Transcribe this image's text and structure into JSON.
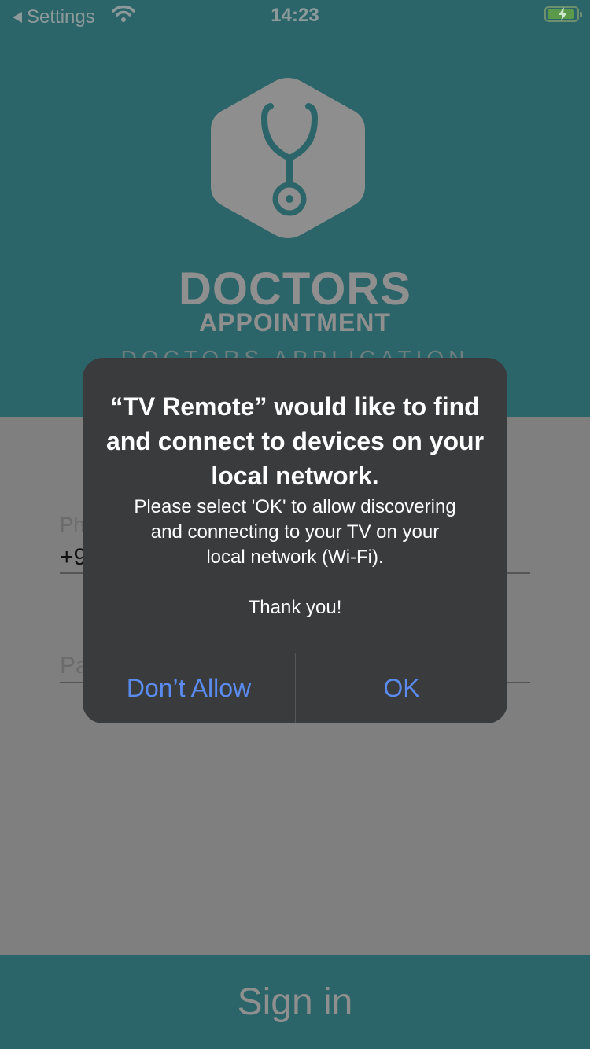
{
  "status_bar": {
    "back_label": "Settings",
    "time": "14:23"
  },
  "brand": {
    "title": "DOCTORS",
    "subtitle": "APPOINTMENT",
    "tagline": "DOCTORS APPLICATION"
  },
  "form": {
    "phone_label": "Ph",
    "phone_value": "+9",
    "password_placeholder": "Pa"
  },
  "signin": {
    "label": "Sign in"
  },
  "alert": {
    "title": "“TV Remote” would like to find and connect to devices on your local network.",
    "message": "Please select 'OK' to allow discovering\nand connecting to your TV on your\nlocal network (Wi-Fi).",
    "thanks": "Thank you!",
    "deny_label": "Don’t Allow",
    "ok_label": "OK"
  },
  "colors": {
    "header_teal": "#2c6569",
    "alert_bg": "#393b3c",
    "alert_button": "#5b8bef"
  },
  "icons": [
    "back-arrow-icon",
    "wifi-icon",
    "battery-charging-icon",
    "stethoscope-logo-icon"
  ]
}
